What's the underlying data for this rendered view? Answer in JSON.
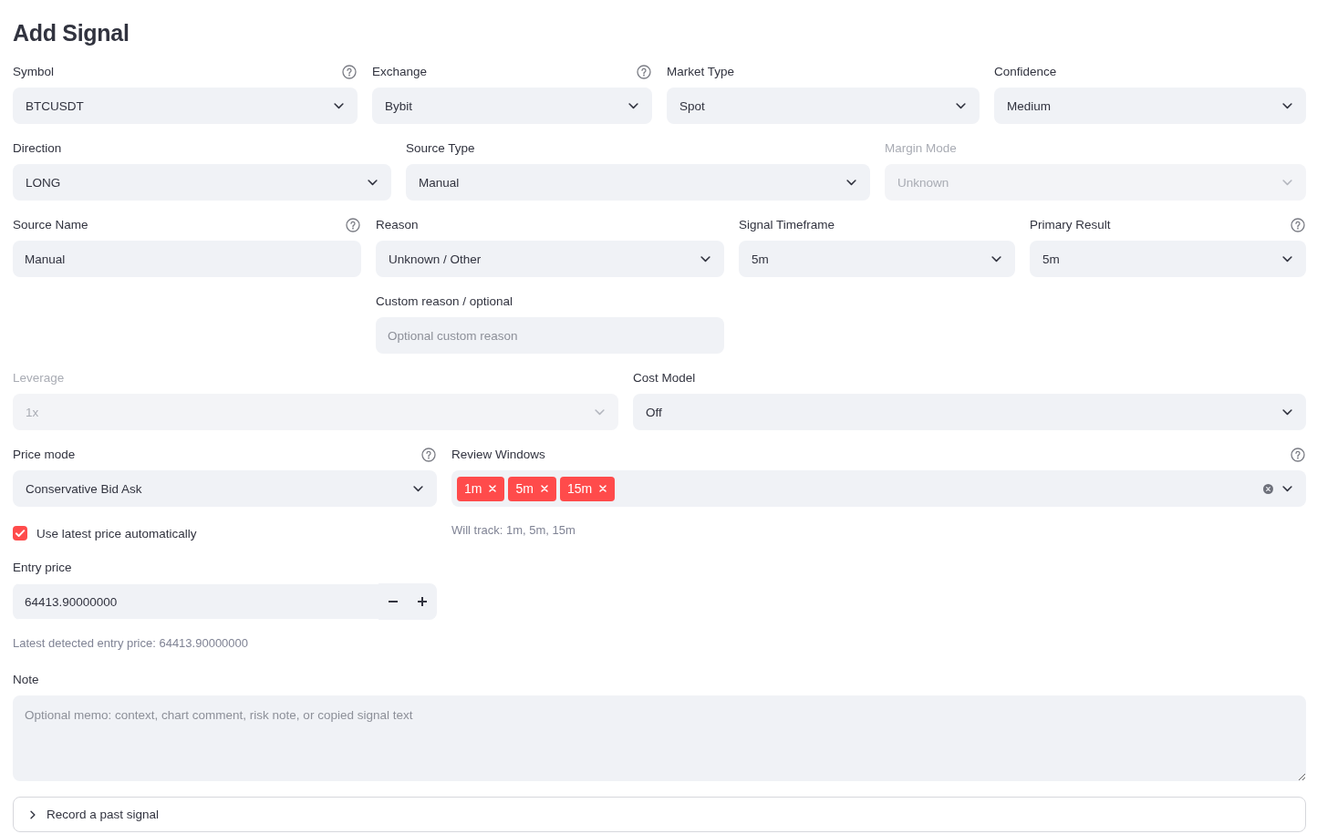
{
  "title": "Add Signal",
  "rows": [
    {
      "columns": [
        {
          "fields": [
            {
              "kind": "select",
              "label": "Symbol",
              "value": "BTCUSDT",
              "help": true,
              "disabled": false
            }
          ]
        },
        {
          "fields": [
            {
              "kind": "select",
              "label": "Exchange",
              "value": "Bybit",
              "help": true,
              "disabled": false
            }
          ]
        },
        {
          "fields": [
            {
              "kind": "select",
              "label": "Market Type",
              "value": "Spot",
              "help": false,
              "disabled": false
            }
          ]
        },
        {
          "fields": [
            {
              "kind": "select",
              "label": "Confidence",
              "value": "Medium",
              "help": false,
              "disabled": false
            }
          ]
        }
      ]
    },
    {
      "columns": [
        {
          "fields": [
            {
              "kind": "select",
              "label": "Direction",
              "value": "LONG",
              "help": false,
              "disabled": false
            }
          ]
        },
        {
          "fields": [
            {
              "kind": "select",
              "label": "Source Type",
              "value": "Manual",
              "help": false,
              "disabled": false
            }
          ]
        },
        {
          "fields": [
            {
              "kind": "select",
              "label": "Margin Mode",
              "value": "Unknown",
              "help": false,
              "disabled": true
            }
          ]
        }
      ]
    },
    {
      "columns": [
        {
          "fields": [
            {
              "kind": "text",
              "label": "Source Name",
              "value": "Manual",
              "help": true,
              "disabled": false
            }
          ]
        },
        {
          "fields": [
            {
              "kind": "select",
              "label": "Reason",
              "value": "Unknown / Other",
              "help": false,
              "disabled": false
            },
            {
              "kind": "text",
              "label": "Custom reason / optional",
              "placeholder": "Optional custom reason",
              "help": false,
              "disabled": false
            }
          ]
        },
        {
          "fields": [
            {
              "kind": "select",
              "label": "Signal Timeframe",
              "value": "5m",
              "help": false,
              "disabled": false
            }
          ]
        },
        {
          "fields": [
            {
              "kind": "select",
              "label": "Primary Result",
              "value": "5m",
              "help": true,
              "disabled": false
            }
          ]
        }
      ]
    },
    {
      "columns": [
        {
          "fields": [
            {
              "kind": "select",
              "label": "Leverage",
              "value": "1x",
              "help": false,
              "disabled": true
            }
          ]
        },
        {
          "fields": [
            {
              "kind": "select",
              "label": "Cost Model",
              "value": "Off",
              "help": false,
              "disabled": false
            }
          ]
        }
      ]
    },
    {
      "columns": [
        {
          "fields": [
            {
              "kind": "select",
              "label": "Price mode",
              "value": "Conservative Bid Ask",
              "help": true,
              "disabled": false
            },
            {
              "kind": "checkbox",
              "label": "Use latest price automatically",
              "checked": true,
              "disabled": false
            },
            {
              "kind": "number",
              "label": "Entry price",
              "value": "64413.90000000",
              "caption": "Latest detected entry price: 64413.90000000",
              "help": false,
              "disabled": false
            }
          ]
        },
        {
          "fields": [
            {
              "kind": "multiselect",
              "label": "Review Windows",
              "tags": [
                "1m",
                "5m",
                "15m"
              ],
              "caption": "Will track: 1m, 5m, 15m",
              "help": true,
              "disabled": false
            }
          ]
        }
      ]
    },
    {
      "columns": [
        {
          "fields": [
            {
              "kind": "textarea",
              "label": "Note",
              "placeholder": "Optional memo: context, chart comment, risk note, or copied signal text",
              "help": false,
              "disabled": false
            }
          ]
        }
      ]
    }
  ],
  "expander": {
    "label": "Record a past signal",
    "expanded": false
  }
}
